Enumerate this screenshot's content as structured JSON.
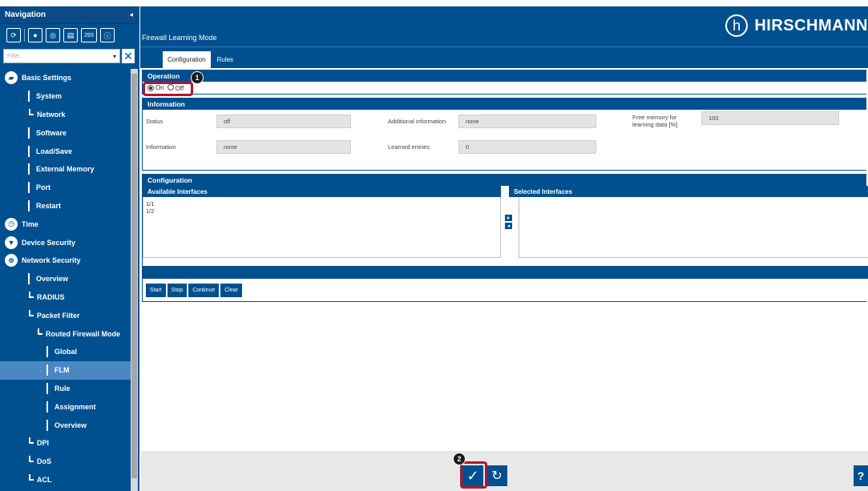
{
  "sidebar": {
    "title": "Navigation",
    "collapse_icon": "◂",
    "toolbar": {
      "badge_number": "293"
    },
    "filter_placeholder": "Filter...",
    "tree": [
      {
        "label": "Basic Settings",
        "type": "top",
        "icon": "folder-icon"
      },
      {
        "label": "System",
        "type": "bar"
      },
      {
        "label": "Network",
        "type": "elbow"
      },
      {
        "label": "Software",
        "type": "bar"
      },
      {
        "label": "Load/Save",
        "type": "bar"
      },
      {
        "label": "External Memory",
        "type": "bar"
      },
      {
        "label": "Port",
        "type": "bar"
      },
      {
        "label": "Restart",
        "type": "bar"
      },
      {
        "label": "Time",
        "type": "top",
        "icon": "clock-icon"
      },
      {
        "label": "Device Security",
        "type": "top",
        "icon": "shield-icon"
      },
      {
        "label": "Network Security",
        "type": "top",
        "icon": "globe-lock-icon"
      },
      {
        "label": "Overview",
        "type": "bar"
      },
      {
        "label": "RADIUS",
        "type": "elbow"
      },
      {
        "label": "Packet Filter",
        "type": "elbow"
      },
      {
        "label": "Routed Firewall Mode",
        "type": "elbow2"
      },
      {
        "label": "Global",
        "type": "bar2"
      },
      {
        "label": "FLM",
        "type": "bar2",
        "active": true
      },
      {
        "label": "Rule",
        "type": "bar2"
      },
      {
        "label": "Assignment",
        "type": "bar2"
      },
      {
        "label": "Overview",
        "type": "bar2"
      },
      {
        "label": "DPI",
        "type": "elbow"
      },
      {
        "label": "DoS",
        "type": "elbow"
      },
      {
        "label": "ACL",
        "type": "elbow"
      }
    ]
  },
  "header": {
    "page_title": "Firewall Learning Mode",
    "brand": "HIRSCHMANN",
    "brand_logo_letter": "h"
  },
  "tabs": [
    {
      "label": "Configuration",
      "active": true
    },
    {
      "label": "Rules",
      "active": false
    }
  ],
  "operation": {
    "title": "Operation",
    "on_label": "On",
    "off_label": "Off",
    "selected": "On"
  },
  "information": {
    "title": "Information",
    "status_label": "Status",
    "status_value": "off",
    "additional_label": "Additional information",
    "additional_value": "none",
    "free_memory_label": "Free memory for learning data [%]",
    "free_memory_value": "100",
    "information_label": "Information",
    "information_value": "none",
    "learned_label": "Learned entries",
    "learned_value": "0"
  },
  "configuration": {
    "title": "Configuration",
    "available_title": "Available Interfaces",
    "selected_title": "Selected Interfaces",
    "available": [
      "1/1",
      "1/2"
    ],
    "selected": [],
    "buttons": [
      "Start",
      "Stop",
      "Continue",
      "Clear"
    ]
  },
  "footer": {
    "apply_icon": "✓",
    "reload_icon": "↻",
    "help_icon": "?"
  },
  "callouts": {
    "first": "1",
    "second": "2"
  }
}
